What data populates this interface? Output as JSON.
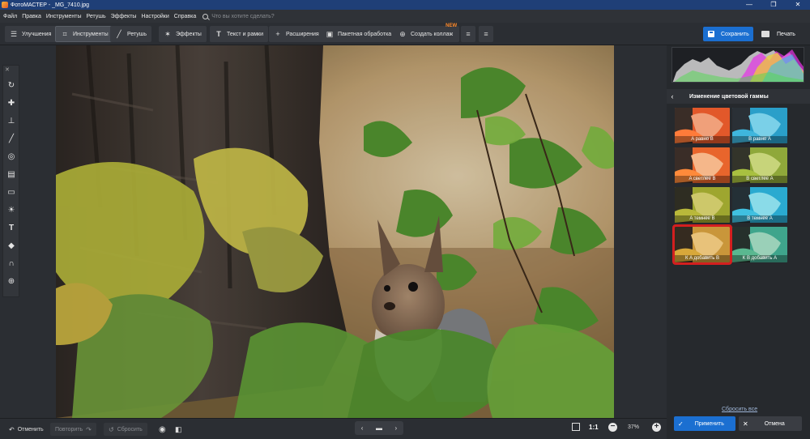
{
  "window": {
    "title": "ФотоМАСТЕР - _MG_7410.jpg",
    "controls": {
      "minimize": "—",
      "maximize": "❐",
      "close": "✕"
    }
  },
  "menu": {
    "items": [
      "Файл",
      "Правка",
      "Инструменты",
      "Ретушь",
      "Эффекты",
      "Настройки",
      "Справка"
    ],
    "search_placeholder": "Что вы хотите сделать?"
  },
  "toolbar": {
    "tabs": [
      {
        "label": "Улучшения",
        "icon": "sliders-icon"
      },
      {
        "label": "Инструменты",
        "icon": "crop-icon",
        "active": true
      },
      {
        "label": "Ретушь",
        "icon": "brush-icon"
      },
      {
        "label": "Эффекты",
        "icon": "sparkle-icon"
      },
      {
        "label": "Текст и рамки",
        "icon": "text-icon"
      },
      {
        "label": "Расширения",
        "icon": "plus-icon"
      }
    ],
    "batch_label": "Пакетная обработка",
    "collage_label": "Создать коллаж",
    "collage_badge": "NEW",
    "save_label": "Сохранить",
    "print_label": "Печать"
  },
  "left_tools": [
    "rotate-icon",
    "patch-icon",
    "stamp-icon",
    "brush-icon",
    "radial-icon",
    "gradient-icon",
    "vignette-icon",
    "light-icon",
    "text-icon",
    "fill-icon",
    "magnet-icon",
    "globe-icon"
  ],
  "bottom": {
    "undo_label": "Отменить",
    "redo_label": "Повторить",
    "reset_label": "Сбросить",
    "zoom_11": "1:1",
    "zoom_value": "37%"
  },
  "panel": {
    "title": "Изменение цветовой гаммы",
    "presets": [
      {
        "label": "A равно B",
        "tint": "#e2582a"
      },
      {
        "label": "B равно A",
        "tint": "#2a9fc9"
      },
      {
        "label": "A светлее B",
        "tint": "#e8652c"
      },
      {
        "label": "B светлее A",
        "tint": "#8fa83a"
      },
      {
        "label": "A темнее B",
        "tint": "#9ea62f"
      },
      {
        "label": "B темнее A",
        "tint": "#2aaad0"
      },
      {
        "label": "К A добавить B",
        "tint": "#c9963a",
        "selected": true
      },
      {
        "label": "К B добавить A",
        "tint": "#3fa58c"
      }
    ],
    "reset_all_label": "Сбросить все",
    "apply_label": "Применить",
    "cancel_label": "Отмена"
  },
  "colors": {
    "accent": "#1b6fd1",
    "selection": "#d41f1f",
    "new_badge": "#ff8a2a"
  }
}
